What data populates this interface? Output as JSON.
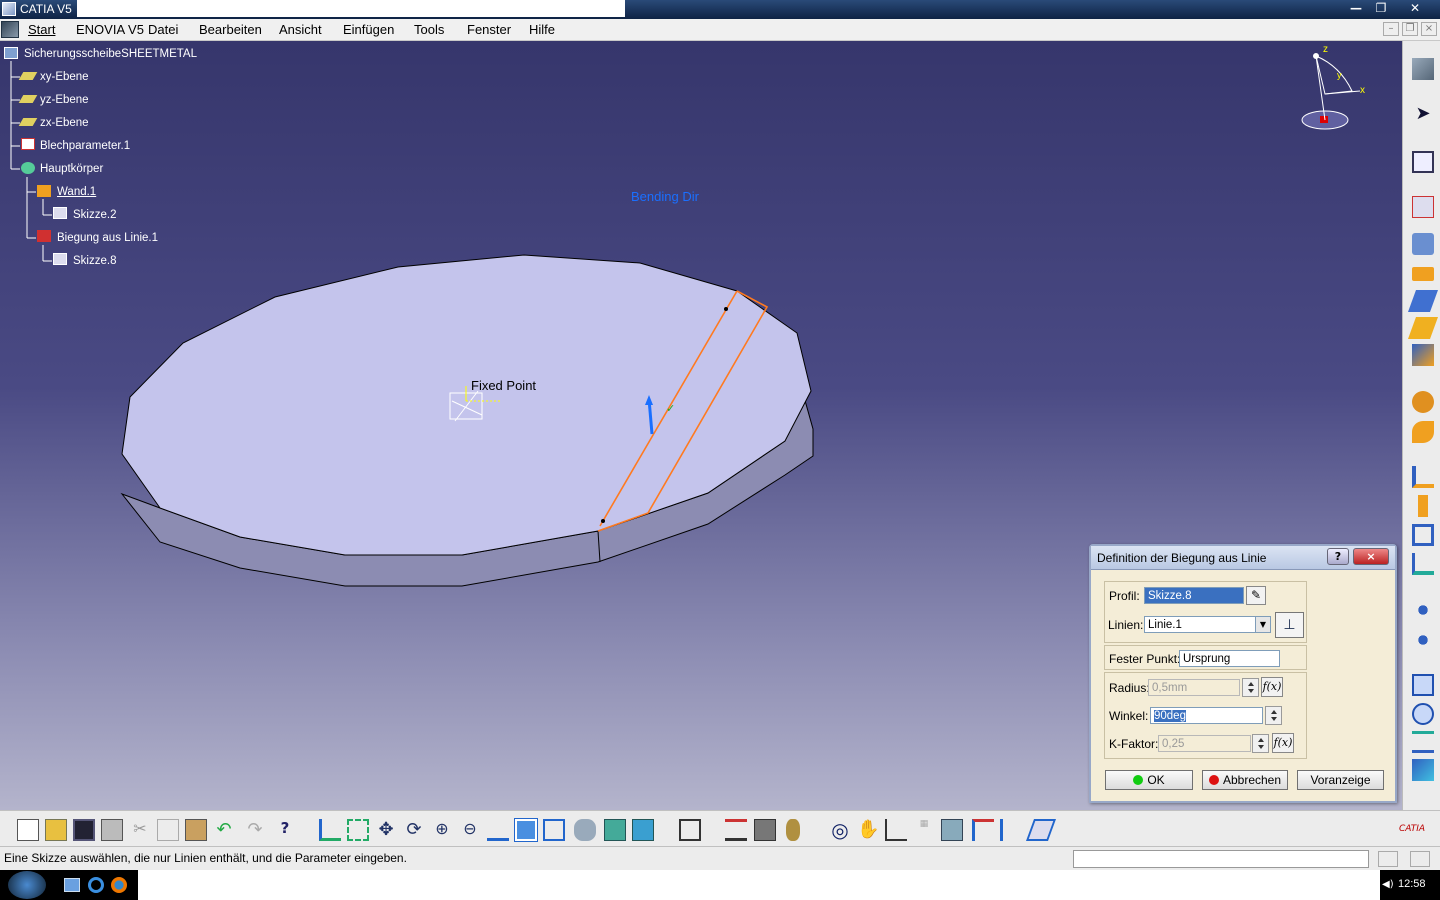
{
  "window": {
    "title": "CATIA V5",
    "controls": [
      "minimize-icon",
      "restore-icon",
      "close-icon"
    ]
  },
  "menubar": {
    "items": [
      "Start",
      "ENOVIA V5",
      "Datei",
      "Bearbeiten",
      "Ansicht",
      "Einfügen",
      "Tools",
      "Fenster",
      "Hilfe"
    ]
  },
  "tree": {
    "root": "SicherungsscheibeSHEETMETAL",
    "nodes": [
      {
        "label": "xy-Ebene",
        "icon": "plane-icon"
      },
      {
        "label": "yz-Ebene",
        "icon": "plane-icon"
      },
      {
        "label": "zx-Ebene",
        "icon": "plane-icon"
      },
      {
        "label": "Blechparameter.1",
        "icon": "sheetmetal-parameters-icon"
      },
      {
        "label": "Hauptkörper",
        "icon": "body-icon"
      },
      {
        "label": "Wand.1",
        "icon": "wall-icon"
      },
      {
        "label": "Skizze.2",
        "icon": "sketch-icon"
      },
      {
        "label": "Biegung aus Linie.1",
        "icon": "bend-from-flat-icon"
      },
      {
        "label": "Skizze.8",
        "icon": "sketch-icon"
      }
    ]
  },
  "viewport": {
    "labels": {
      "bending_dir": "Bending Dir",
      "fixed_point": "Fixed Point"
    },
    "compass": {
      "x": "x",
      "y": "y",
      "z": "z"
    },
    "colors": {
      "bending_dir": "#1a6fff",
      "bend_line": "#ff7a20",
      "part_face": "#c4c4ec"
    }
  },
  "dialog": {
    "title": "Definition der Biegung aus Linie",
    "help_label": "?",
    "close_label": "×",
    "profile_label": "Profil:",
    "profile_value": "Skizze.8",
    "lines_label": "Linien:",
    "lines_value": "Linie.1",
    "fixed_point_label": "Fester Punkt:",
    "fixed_point_value": "Ursprung",
    "radius_label": "Radius:",
    "radius_value": "0,5mm",
    "angle_label": "Winkel:",
    "angle_value": "90deg",
    "kfactor_label": "K-Faktor:",
    "kfactor_value": "0,25",
    "fx_label": "f(x)",
    "ok_label": "OK",
    "cancel_label": "Abbrechen",
    "preview_label": "Voranzeige"
  },
  "statusbar": {
    "message": "Eine Skizze auswählen, die nur Linien enthält, und die Parameter eingeben."
  },
  "taskbar": {
    "clock": "12:58"
  }
}
